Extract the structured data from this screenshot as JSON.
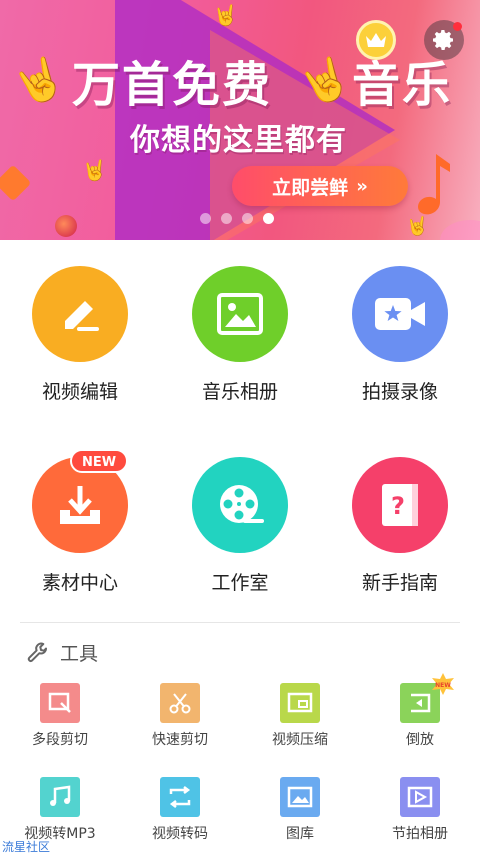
{
  "banner": {
    "title_left": "万首免费",
    "title_right": "音乐",
    "subtitle": "你想的这里都有",
    "cta_label": "立即尝鲜",
    "page_count": 4,
    "active_page": 4
  },
  "features": [
    {
      "label": "视频编辑",
      "color": "#f9ad22",
      "icon": "pencil-icon"
    },
    {
      "label": "音乐相册",
      "color": "#6fcf2a",
      "icon": "picture-icon"
    },
    {
      "label": "拍摄录像",
      "color": "#6a8ff2",
      "icon": "video-camera-icon"
    },
    {
      "label": "素材中心",
      "color": "#ff6a3a",
      "icon": "download-tray-icon",
      "badge": "NEW"
    },
    {
      "label": "工作室",
      "color": "#22d3c0",
      "icon": "film-reel-icon"
    },
    {
      "label": "新手指南",
      "color": "#f5406a",
      "icon": "question-book-icon"
    }
  ],
  "tools": {
    "header": "工具",
    "items": [
      {
        "label": "多段剪切",
        "color": "#f48b8b",
        "icon": "multi-cut-icon"
      },
      {
        "label": "快速剪切",
        "color": "#f2b56e",
        "icon": "scissors-icon"
      },
      {
        "label": "视频压缩",
        "color": "#b9d84a",
        "icon": "compress-icon"
      },
      {
        "label": "倒放",
        "color": "#8bd35a",
        "icon": "reverse-icon",
        "badge": "NEW"
      },
      {
        "label": "视频转MP3",
        "color": "#53d3cf",
        "icon": "music-note-icon"
      },
      {
        "label": "视频转码",
        "color": "#4fc3e6",
        "icon": "convert-icon"
      },
      {
        "label": "图库",
        "color": "#6aaaf0",
        "icon": "gallery-icon"
      },
      {
        "label": "节拍相册",
        "color": "#8a8ff0",
        "icon": "beat-album-icon"
      }
    ]
  },
  "watermark": "流星社区"
}
